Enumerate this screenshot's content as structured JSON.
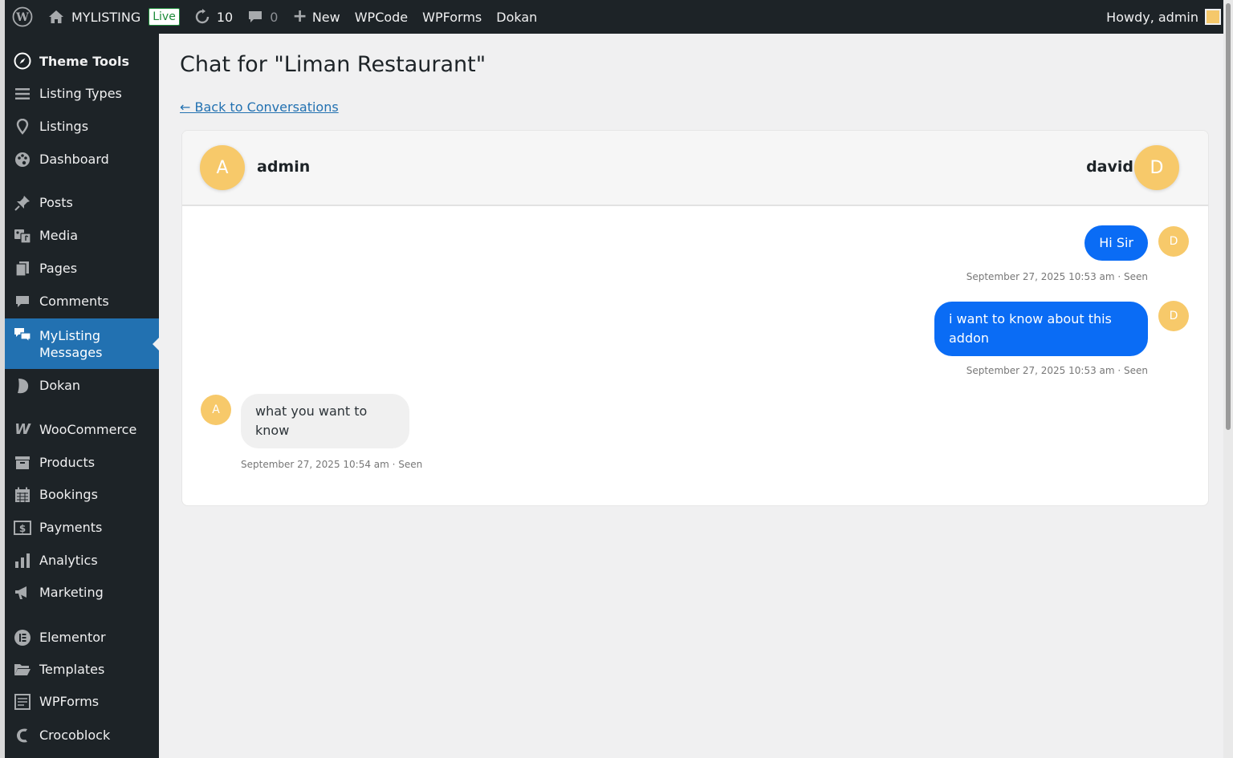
{
  "adminbar": {
    "site_name": "MYLISTING",
    "live_badge": "Live",
    "updates_count": "10",
    "comments_count": "0",
    "new_label": "New",
    "links": [
      "WPCode",
      "WPForms",
      "Dokan"
    ],
    "greeting": "Howdy, admin"
  },
  "sidebar": {
    "items": [
      {
        "label": "Theme Tools",
        "icon": "compass-icon"
      },
      {
        "label": "Listing Types",
        "icon": "list-icon"
      },
      {
        "label": "Listings",
        "icon": "location-pin-icon"
      },
      {
        "label": "Dashboard",
        "icon": "palette-icon"
      },
      {
        "label": "Posts",
        "icon": "pushpin-icon"
      },
      {
        "label": "Media",
        "icon": "media-icon"
      },
      {
        "label": "Pages",
        "icon": "pages-icon"
      },
      {
        "label": "Comments",
        "icon": "comment-icon"
      },
      {
        "label": "MyListing Messages",
        "icon": "chat-bubbles-icon"
      },
      {
        "label": "Dokan",
        "icon": "dokan-icon"
      },
      {
        "label": "WooCommerce",
        "icon": "woocommerce-icon"
      },
      {
        "label": "Products",
        "icon": "archive-box-icon"
      },
      {
        "label": "Bookings",
        "icon": "calendar-icon"
      },
      {
        "label": "Payments",
        "icon": "dollar-icon"
      },
      {
        "label": "Analytics",
        "icon": "bar-chart-icon"
      },
      {
        "label": "Marketing",
        "icon": "megaphone-icon"
      },
      {
        "label": "Elementor",
        "icon": "elementor-icon"
      },
      {
        "label": "Templates",
        "icon": "folder-icon"
      },
      {
        "label": "WPForms",
        "icon": "form-icon"
      },
      {
        "label": "Crocoblock",
        "icon": "crocoblock-icon"
      }
    ]
  },
  "page": {
    "title": "Chat for \"Liman Restaurant\"",
    "back_link": "← Back to Conversations"
  },
  "chat": {
    "header": {
      "left_user": {
        "name": "admin",
        "initial": "A"
      },
      "right_user": {
        "name": "david",
        "initial": "D"
      }
    },
    "messages": [
      {
        "text": "Hi Sir",
        "initial": "D",
        "meta": "September 27, 2025 10:53 am · Seen",
        "direction": "outgoing"
      },
      {
        "text": "i want to know about this addon",
        "initial": "D",
        "meta": "September 27, 2025 10:53 am · Seen",
        "direction": "outgoing"
      },
      {
        "text": "what you want to know",
        "initial": "A",
        "meta": "September 27, 2025 10:54 am · Seen",
        "direction": "incoming"
      }
    ]
  },
  "colors": {
    "adminbar_bg": "#1d2327",
    "menu_current": "#2271b1",
    "outgoing_bubble": "#0a6cf5",
    "incoming_bubble": "#f0f0f0",
    "avatar": "#f7c96a",
    "link": "#2271b1"
  }
}
